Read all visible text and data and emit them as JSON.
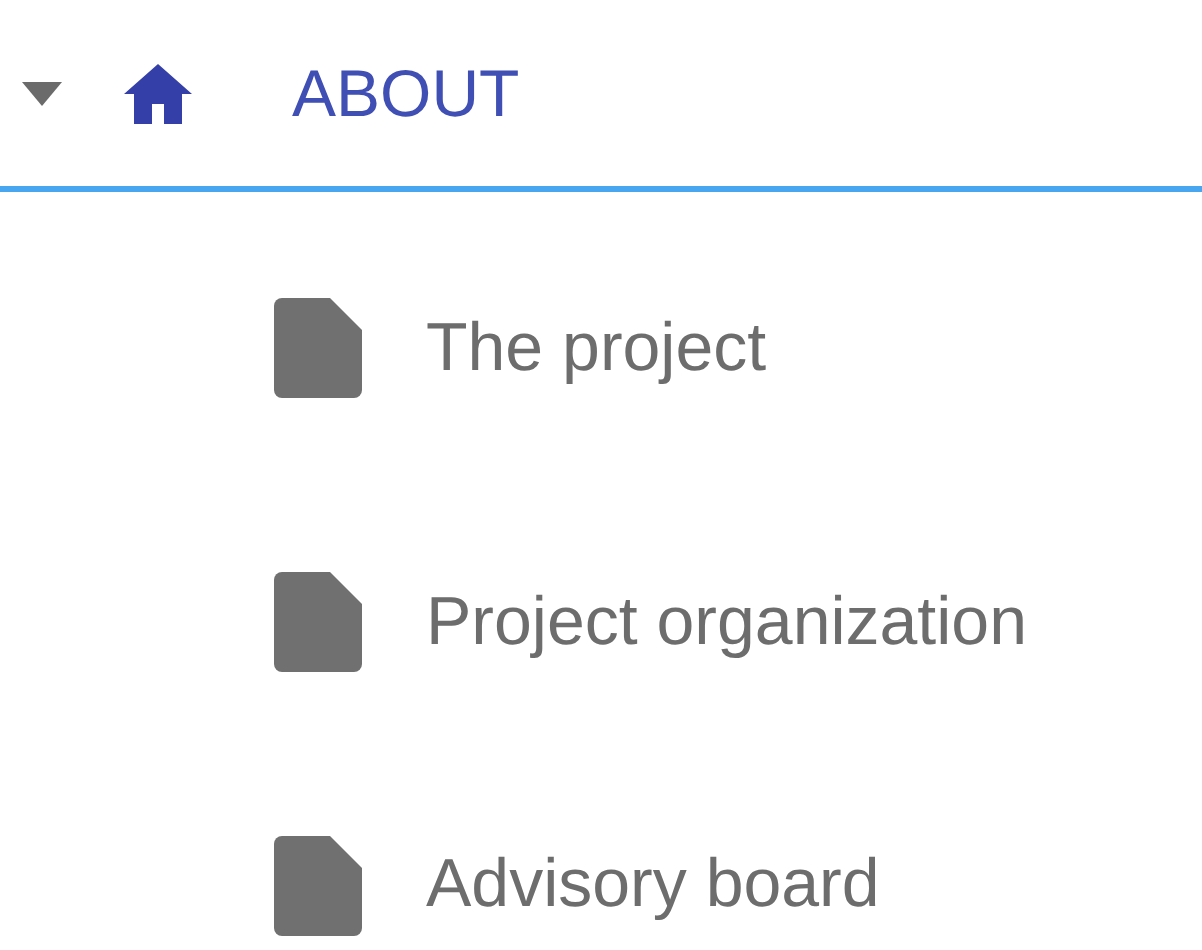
{
  "tree": [
    {
      "label": "ABOUT",
      "expanded": true,
      "children": [
        {
          "label": "The project"
        },
        {
          "label": "Project organization"
        },
        {
          "label": "Advisory board"
        }
      ]
    }
  ]
}
